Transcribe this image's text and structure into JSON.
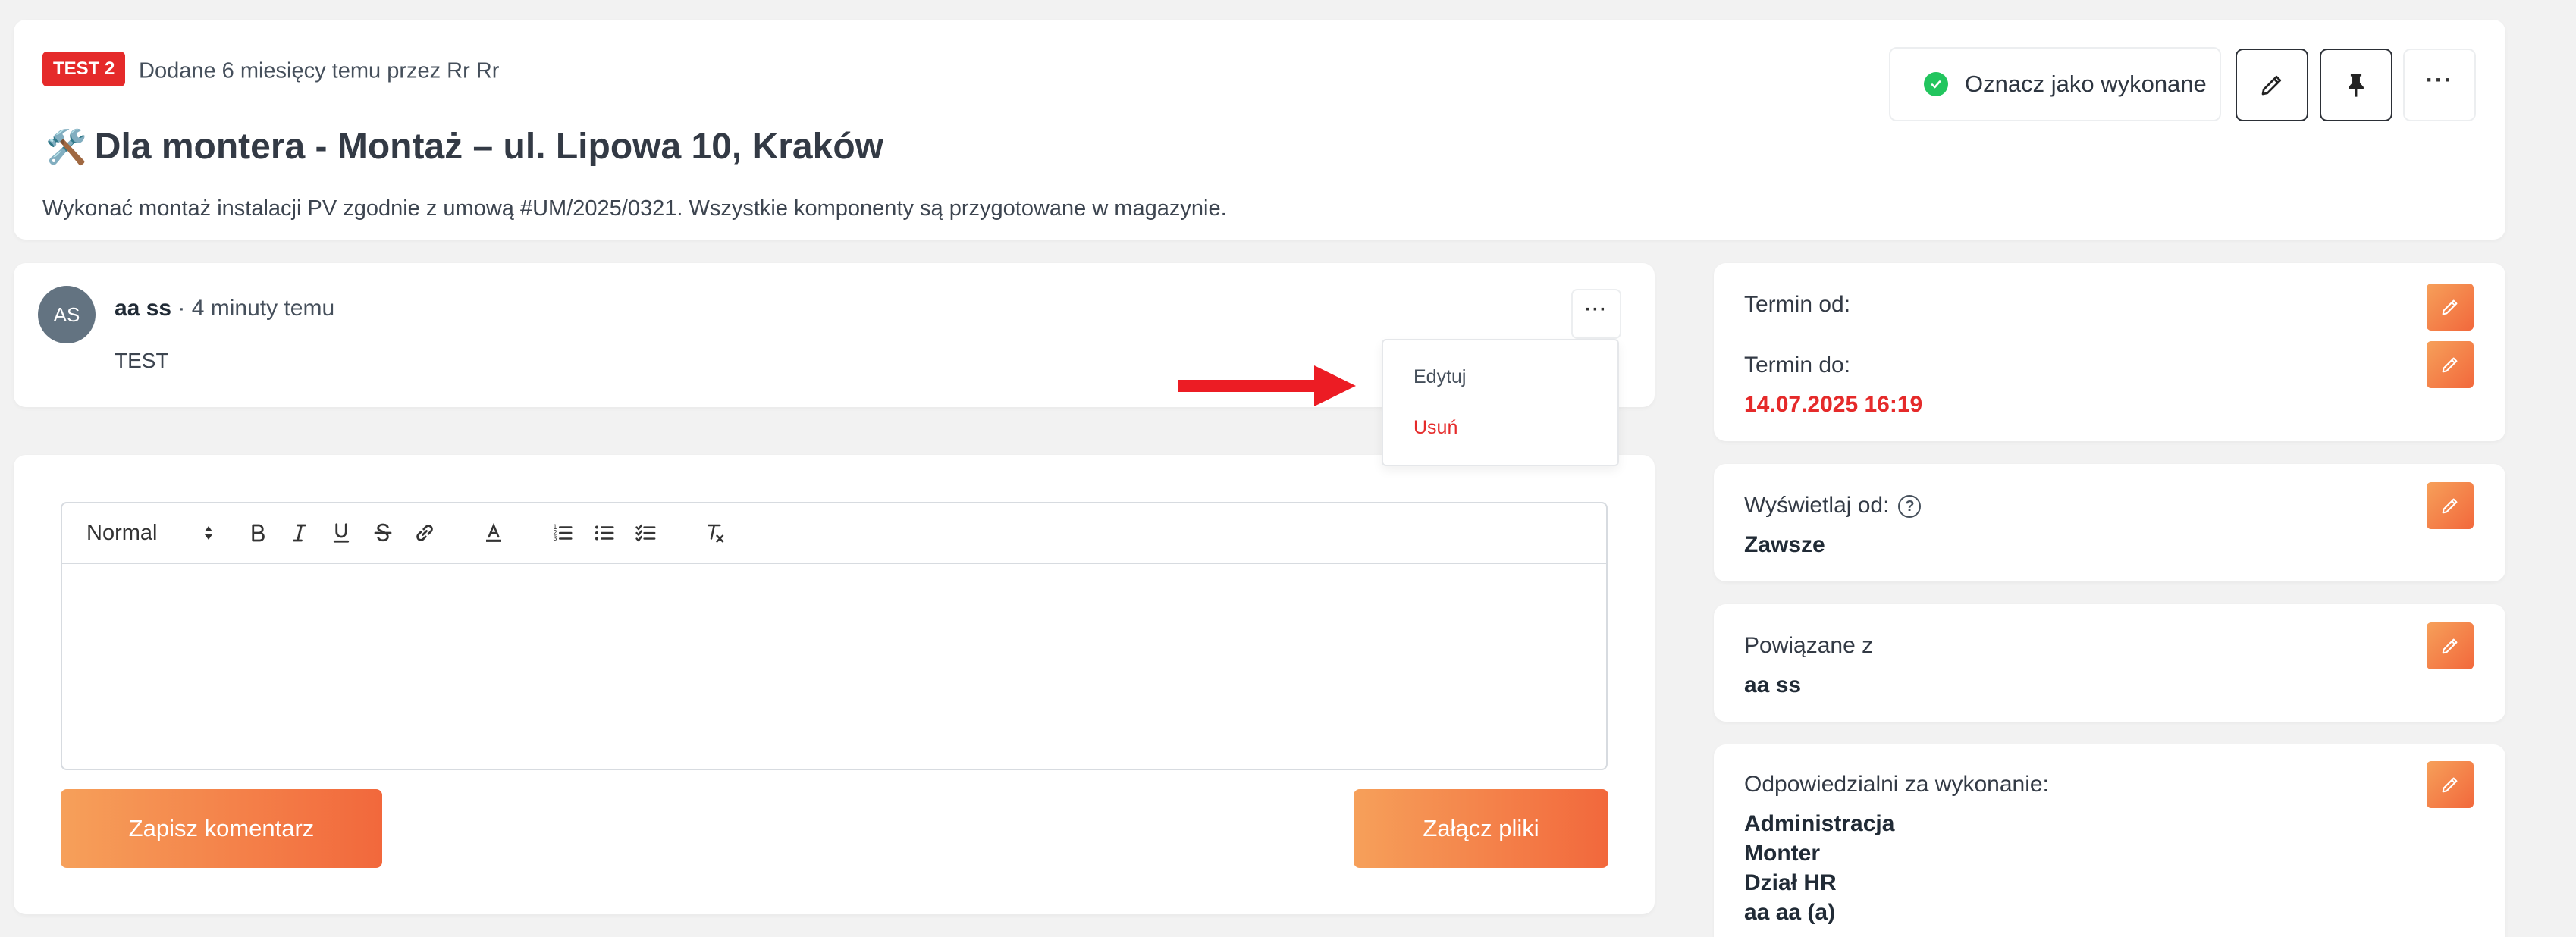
{
  "header": {
    "tag": "TEST 2",
    "meta": "Dodane 6 miesięcy temu przez Rr Rr",
    "title_emoji": "🛠️",
    "title": "Dla montera - Montaż – ul. Lipowa 10, Kraków",
    "description": "Wykonać montaż instalacji PV zgodnie z umową #UM/2025/0321. Wszystkie komponenty są przygotowane w magazynie.",
    "mark_done_label": "Oznacz jako wykonane",
    "more_label": "···"
  },
  "comment": {
    "avatar_initials": "AS",
    "author": "aa ss",
    "time": " · 4 minuty temu",
    "text": "TEST",
    "more_label": "···"
  },
  "dropdown": {
    "edit": "Edytuj",
    "delete": "Usuń"
  },
  "editor": {
    "format": "Normal",
    "save_label": "Zapisz komentarz",
    "attach_label": "Załącz pliki"
  },
  "sidebar": {
    "term_from_label": "Termin od:",
    "term_to_label": "Termin do:",
    "term_to_value": "14.07.2025 16:19",
    "display_from_label": "Wyświetlaj od:",
    "display_from_value": "Zawsze",
    "related_label": "Powiązane z",
    "related_value": "aa ss",
    "responsible_label": "Odpowiedzialni za wykonanie:",
    "responsible": [
      "Administracja",
      "Monter",
      "Dział HR",
      "aa aa (a)"
    ]
  },
  "colors": {
    "accent_orange": "#f2683c",
    "danger_red": "#e52a2a",
    "success_green": "#22c55e"
  }
}
